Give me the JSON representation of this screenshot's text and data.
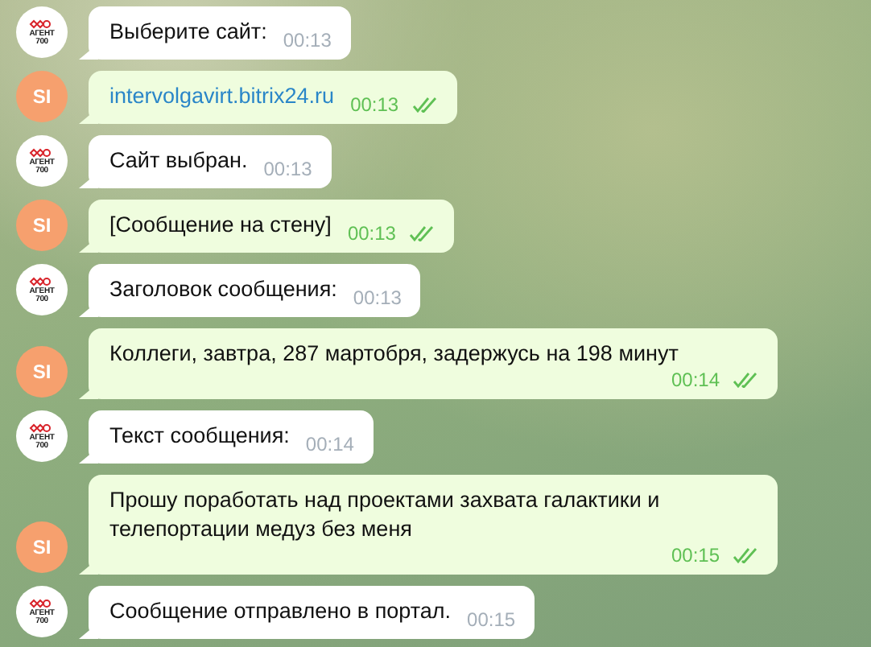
{
  "messages": [
    {
      "outgoing": false,
      "avatar": [
        "АГЕНТ",
        "700"
      ],
      "kind": "text",
      "text": "Выберите сайт:",
      "time": "00:13"
    },
    {
      "outgoing": true,
      "avatar": [
        "SI"
      ],
      "kind": "link",
      "text": "intervolgavirt.bitrix24.ru",
      "time": "00:13",
      "read": true
    },
    {
      "outgoing": false,
      "avatar": [
        "АГЕНТ",
        "700"
      ],
      "kind": "text",
      "text": "Сайт выбран.",
      "time": "00:13"
    },
    {
      "outgoing": true,
      "avatar": [
        "SI"
      ],
      "kind": "text",
      "text": "[Сообщение на стену]",
      "time": "00:13",
      "read": true
    },
    {
      "outgoing": false,
      "avatar": [
        "АГЕНТ",
        "700"
      ],
      "kind": "text",
      "text": "Заголовок сообщения:",
      "time": "00:13"
    },
    {
      "outgoing": true,
      "avatar": [
        "SI"
      ],
      "kind": "text",
      "text": "Коллеги, завтра, 287 мартобря, задержусь на 198 минут",
      "time": "00:14",
      "read": true
    },
    {
      "outgoing": false,
      "avatar": [
        "АГЕНТ",
        "700"
      ],
      "kind": "text",
      "text": "Текст сообщения:",
      "time": "00:14"
    },
    {
      "outgoing": true,
      "avatar": [
        "SI"
      ],
      "kind": "text",
      "text": "Прошу поработать над проектами захвата галактики и телепортации медуз без меня",
      "time": "00:15",
      "read": true
    },
    {
      "outgoing": false,
      "avatar": [
        "АГЕНТ",
        "700"
      ],
      "kind": "text",
      "text": "Сообщение отправлено в портал.",
      "time": "00:15"
    }
  ]
}
